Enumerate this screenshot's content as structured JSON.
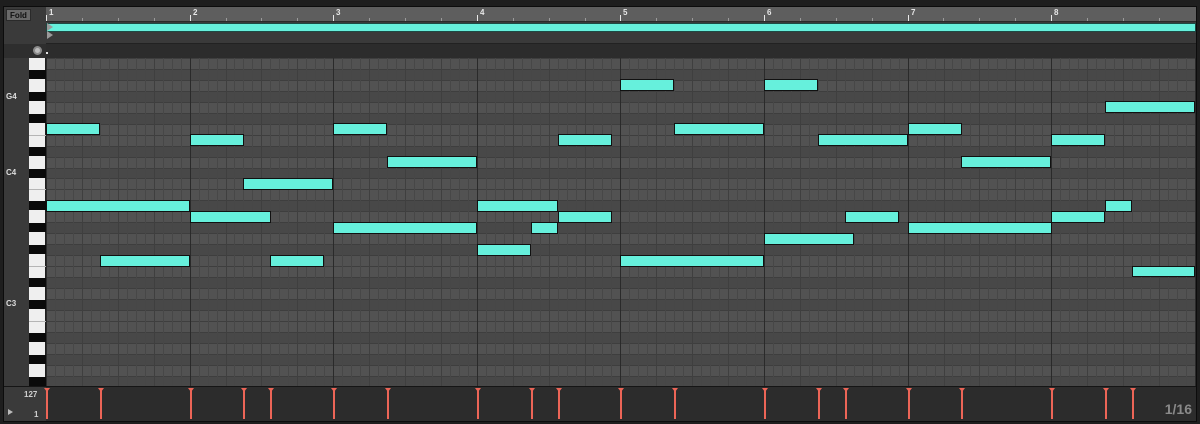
{
  "toolbar": {
    "fold_label": "Fold"
  },
  "ruler": {
    "bars": [
      "1",
      "2",
      "3",
      "4",
      "5",
      "6",
      "7",
      "8"
    ]
  },
  "keyboard": {
    "labels": [
      "G4",
      "C4",
      "C3"
    ]
  },
  "velocity": {
    "max_label": "127",
    "min_label": "1"
  },
  "status": {
    "grid_label": "1/16"
  },
  "icons": {
    "fold": "fold-button",
    "loop_brace": "loop-brace-icon",
    "playhead": "play-icon",
    "marker": "marker-icon",
    "preview": "circle-icon"
  },
  "colors": {
    "note": "#66f0dc",
    "velocity": "#ec6557",
    "background": "#1e1e1e"
  },
  "clip": {
    "length_beats": 32,
    "notes": [
      {
        "pitch": "A#3",
        "start": 0,
        "length": 4
      },
      {
        "pitch": "F4",
        "start": 0,
        "length": 1.5
      },
      {
        "pitch": "F3",
        "start": 1.5,
        "length": 2.5
      },
      {
        "pitch": "E4",
        "start": 4,
        "length": 1.5
      },
      {
        "pitch": "A3",
        "start": 4,
        "length": 2.25
      },
      {
        "pitch": "C4",
        "start": 5.5,
        "length": 2.5
      },
      {
        "pitch": "F3",
        "start": 6.25,
        "length": 1.5
      },
      {
        "pitch": "F4",
        "start": 8,
        "length": 1.5
      },
      {
        "pitch": "G#3",
        "start": 8,
        "length": 4
      },
      {
        "pitch": "D4",
        "start": 9.5,
        "length": 2.5
      },
      {
        "pitch": "A#3",
        "start": 12,
        "length": 2.25
      },
      {
        "pitch": "F#3",
        "start": 12,
        "length": 1.5
      },
      {
        "pitch": "G#3",
        "start": 13.5,
        "length": 0.75
      },
      {
        "pitch": "E4",
        "start": 14.25,
        "length": 1.5
      },
      {
        "pitch": "A3",
        "start": 14.25,
        "length": 1.5
      },
      {
        "pitch": "A4",
        "start": 16,
        "length": 1.5
      },
      {
        "pitch": "F3",
        "start": 16,
        "length": 4
      },
      {
        "pitch": "F4",
        "start": 17.5,
        "length": 2.5
      },
      {
        "pitch": "A4",
        "start": 20,
        "length": 1.5
      },
      {
        "pitch": "G3",
        "start": 20,
        "length": 2.5
      },
      {
        "pitch": "E4",
        "start": 21.5,
        "length": 2.5
      },
      {
        "pitch": "A3",
        "start": 22.25,
        "length": 1.5
      },
      {
        "pitch": "F4",
        "start": 24,
        "length": 1.5
      },
      {
        "pitch": "G#3",
        "start": 24,
        "length": 4
      },
      {
        "pitch": "D4",
        "start": 25.5,
        "length": 2.5
      },
      {
        "pitch": "E4",
        "start": 28,
        "length": 1.5
      },
      {
        "pitch": "A3",
        "start": 28,
        "length": 1.5
      },
      {
        "pitch": "A#3",
        "start": 29.5,
        "length": 0.75
      },
      {
        "pitch": "G4",
        "start": 29.5,
        "length": 2.5
      },
      {
        "pitch": "E3",
        "start": 30.25,
        "length": 1.75
      }
    ]
  }
}
